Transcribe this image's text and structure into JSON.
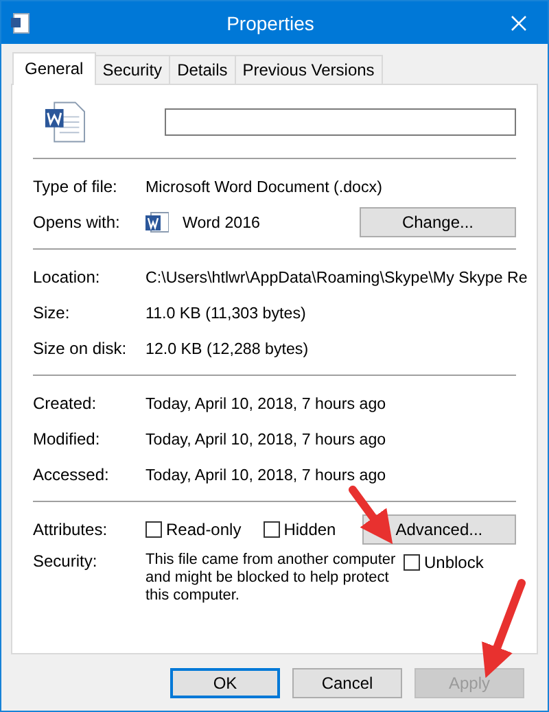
{
  "window": {
    "title": "Properties"
  },
  "tabs": [
    {
      "label": "General",
      "selected": true
    },
    {
      "label": "Security",
      "selected": false
    },
    {
      "label": "Details",
      "selected": false
    },
    {
      "label": "Previous Versions",
      "selected": false
    }
  ],
  "sections": [
    {
      "rows": [
        {
          "kind": "text",
          "label": "Type of file:",
          "value": "Microsoft Word Document (.docx)"
        },
        {
          "kind": "app",
          "label": "Opens with:",
          "value": "Word 2016",
          "button": "Change..."
        }
      ]
    },
    {
      "rows": [
        {
          "kind": "text",
          "label": "Location:",
          "value": "C:\\Users\\htlwr\\AppData\\Roaming\\Skype\\My Skype Re"
        },
        {
          "kind": "text",
          "label": "Size:",
          "value": "11.0 KB (11,303 bytes)"
        },
        {
          "kind": "text",
          "label": "Size on disk:",
          "value": "12.0 KB (12,288 bytes)"
        }
      ]
    },
    {
      "rows": [
        {
          "kind": "text",
          "label": "Created:",
          "value": "Today, April 10, 2018, 7 hours ago"
        },
        {
          "kind": "text",
          "label": "Modified:",
          "value": "Today, April 10, 2018, 7 hours ago"
        },
        {
          "kind": "text",
          "label": "Accessed:",
          "value": "Today, April 10, 2018, 7 hours ago"
        }
      ]
    },
    {
      "rows": [
        {
          "kind": "attributes",
          "label": "Attributes:",
          "options": [
            {
              "label": "Read-only",
              "checked": false
            },
            {
              "label": "Hidden",
              "checked": false
            }
          ],
          "button": "Advanced..."
        },
        {
          "kind": "security",
          "label": "Security:",
          "value": "This file came from another computer and might be blocked to help protect this computer.",
          "option": {
            "label": "Unblock",
            "checked": false
          }
        }
      ]
    }
  ],
  "buttons": [
    {
      "label": "OK",
      "default": true,
      "disabled": false
    },
    {
      "label": "Cancel",
      "default": false,
      "disabled": false
    },
    {
      "label": "Apply",
      "default": false,
      "disabled": true
    }
  ]
}
